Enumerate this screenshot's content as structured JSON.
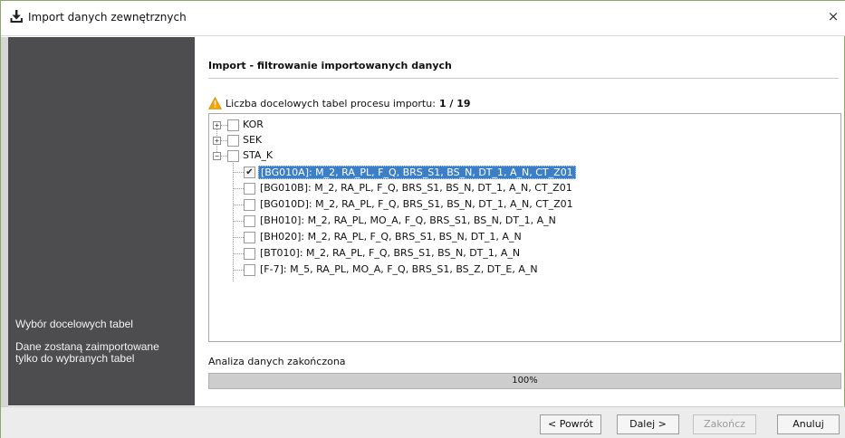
{
  "window": {
    "title": "Import danych zewnętrznych",
    "close_glyph": "×"
  },
  "sidebar": {
    "heading": "Wybór docelowych tabel",
    "description": "Dane zostaną zaimportowane tylko do wybranych tabel"
  },
  "main": {
    "title": "Import - filtrowanie importowanych danych",
    "warning_label": "Liczba docelowych tabel procesu importu:",
    "warning_count": "1 / 19"
  },
  "tree": {
    "groups": [
      {
        "expander": "+",
        "label": "KOR",
        "checked": false
      },
      {
        "expander": "+",
        "label": "SEK",
        "checked": false
      },
      {
        "expander": "−",
        "label": "STA_K",
        "checked": false
      }
    ],
    "items": [
      {
        "label": "[BG010A]: M_2, RA_PL, F_Q, BRS_S1, BS_N, DT_1, A_N, CT_Z01",
        "checked": true,
        "selected": true
      },
      {
        "label": "[BG010B]: M_2, RA_PL, F_Q, BRS_S1, BS_N, DT_1, A_N, CT_Z01",
        "checked": false,
        "selected": false
      },
      {
        "label": "[BG010D]: M_2, RA_PL, F_Q, BRS_S1, BS_N, DT_1, A_N, CT_Z01",
        "checked": false,
        "selected": false
      },
      {
        "label": "[BH010]: M_2, RA_PL, MO_A, F_Q, BRS_S1, BS_N, DT_1, A_N",
        "checked": false,
        "selected": false
      },
      {
        "label": "[BH020]: M_2, RA_PL, F_Q, BRS_S1, BS_N, DT_1, A_N",
        "checked": false,
        "selected": false
      },
      {
        "label": "[BT010]: M_2, RA_PL, F_Q, BRS_S1, BS_N, DT_1, A_N",
        "checked": false,
        "selected": false
      },
      {
        "label": "[F-7]: M_5, RA_PL, MO_A, F_Q, BRS_S1, BS_Z, DT_E, A_N",
        "checked": false,
        "selected": false
      }
    ]
  },
  "status": {
    "text": "Analiza danych zakończona",
    "progress_percent": 100,
    "progress_label": "100%"
  },
  "buttons": {
    "back": "< Powrót",
    "next": "Dalej >",
    "finish": "Zakończ",
    "cancel": "Anuluj"
  },
  "colors": {
    "sidebar_bg": "#4d4d4f",
    "selection": "#3c7fc9",
    "warning": "#f0a500"
  },
  "icons": {
    "title": "import-download-icon",
    "warning": "warning-triangle-icon",
    "close": "close-icon"
  }
}
